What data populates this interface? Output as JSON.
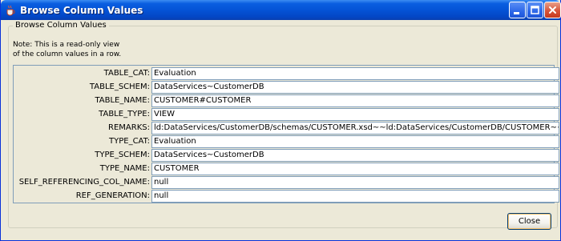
{
  "window": {
    "title": "Browse Column Values",
    "accent_color": "#0453d6",
    "close_color": "#d8553a"
  },
  "group": {
    "legend": "Browse Column Values",
    "note_line1": "Note: This is a read-only view",
    "note_line2": "of the column values in a row."
  },
  "fields": [
    {
      "label": "TABLE_CAT:",
      "value": "Evaluation"
    },
    {
      "label": "TABLE_SCHEM:",
      "value": "DataServices~CustomerDB"
    },
    {
      "label": "TABLE_NAME:",
      "value": "CUSTOMER#CUSTOMER"
    },
    {
      "label": "TABLE_TYPE:",
      "value": "VIEW"
    },
    {
      "label": "REMARKS:",
      "value": "ld:DataServices/CustomerDB/schemas/CUSTOMER.xsd~~ld:DataServices/CustomerDB/CUSTOMER~~CUSTOMER"
    },
    {
      "label": "TYPE_CAT:",
      "value": "Evaluation"
    },
    {
      "label": "TYPE_SCHEM:",
      "value": "DataServices~CustomerDB"
    },
    {
      "label": "TYPE_NAME:",
      "value": "CUSTOMER"
    },
    {
      "label": "SELF_REFERENCING_COL_NAME:",
      "value": "null"
    },
    {
      "label": "REF_GENERATION:",
      "value": "null"
    }
  ],
  "buttons": {
    "close_label": "Close"
  },
  "icons": {
    "app": "java-cup-icon",
    "minimize": "minimize-icon",
    "maximize": "maximize-icon",
    "close": "close-icon"
  }
}
